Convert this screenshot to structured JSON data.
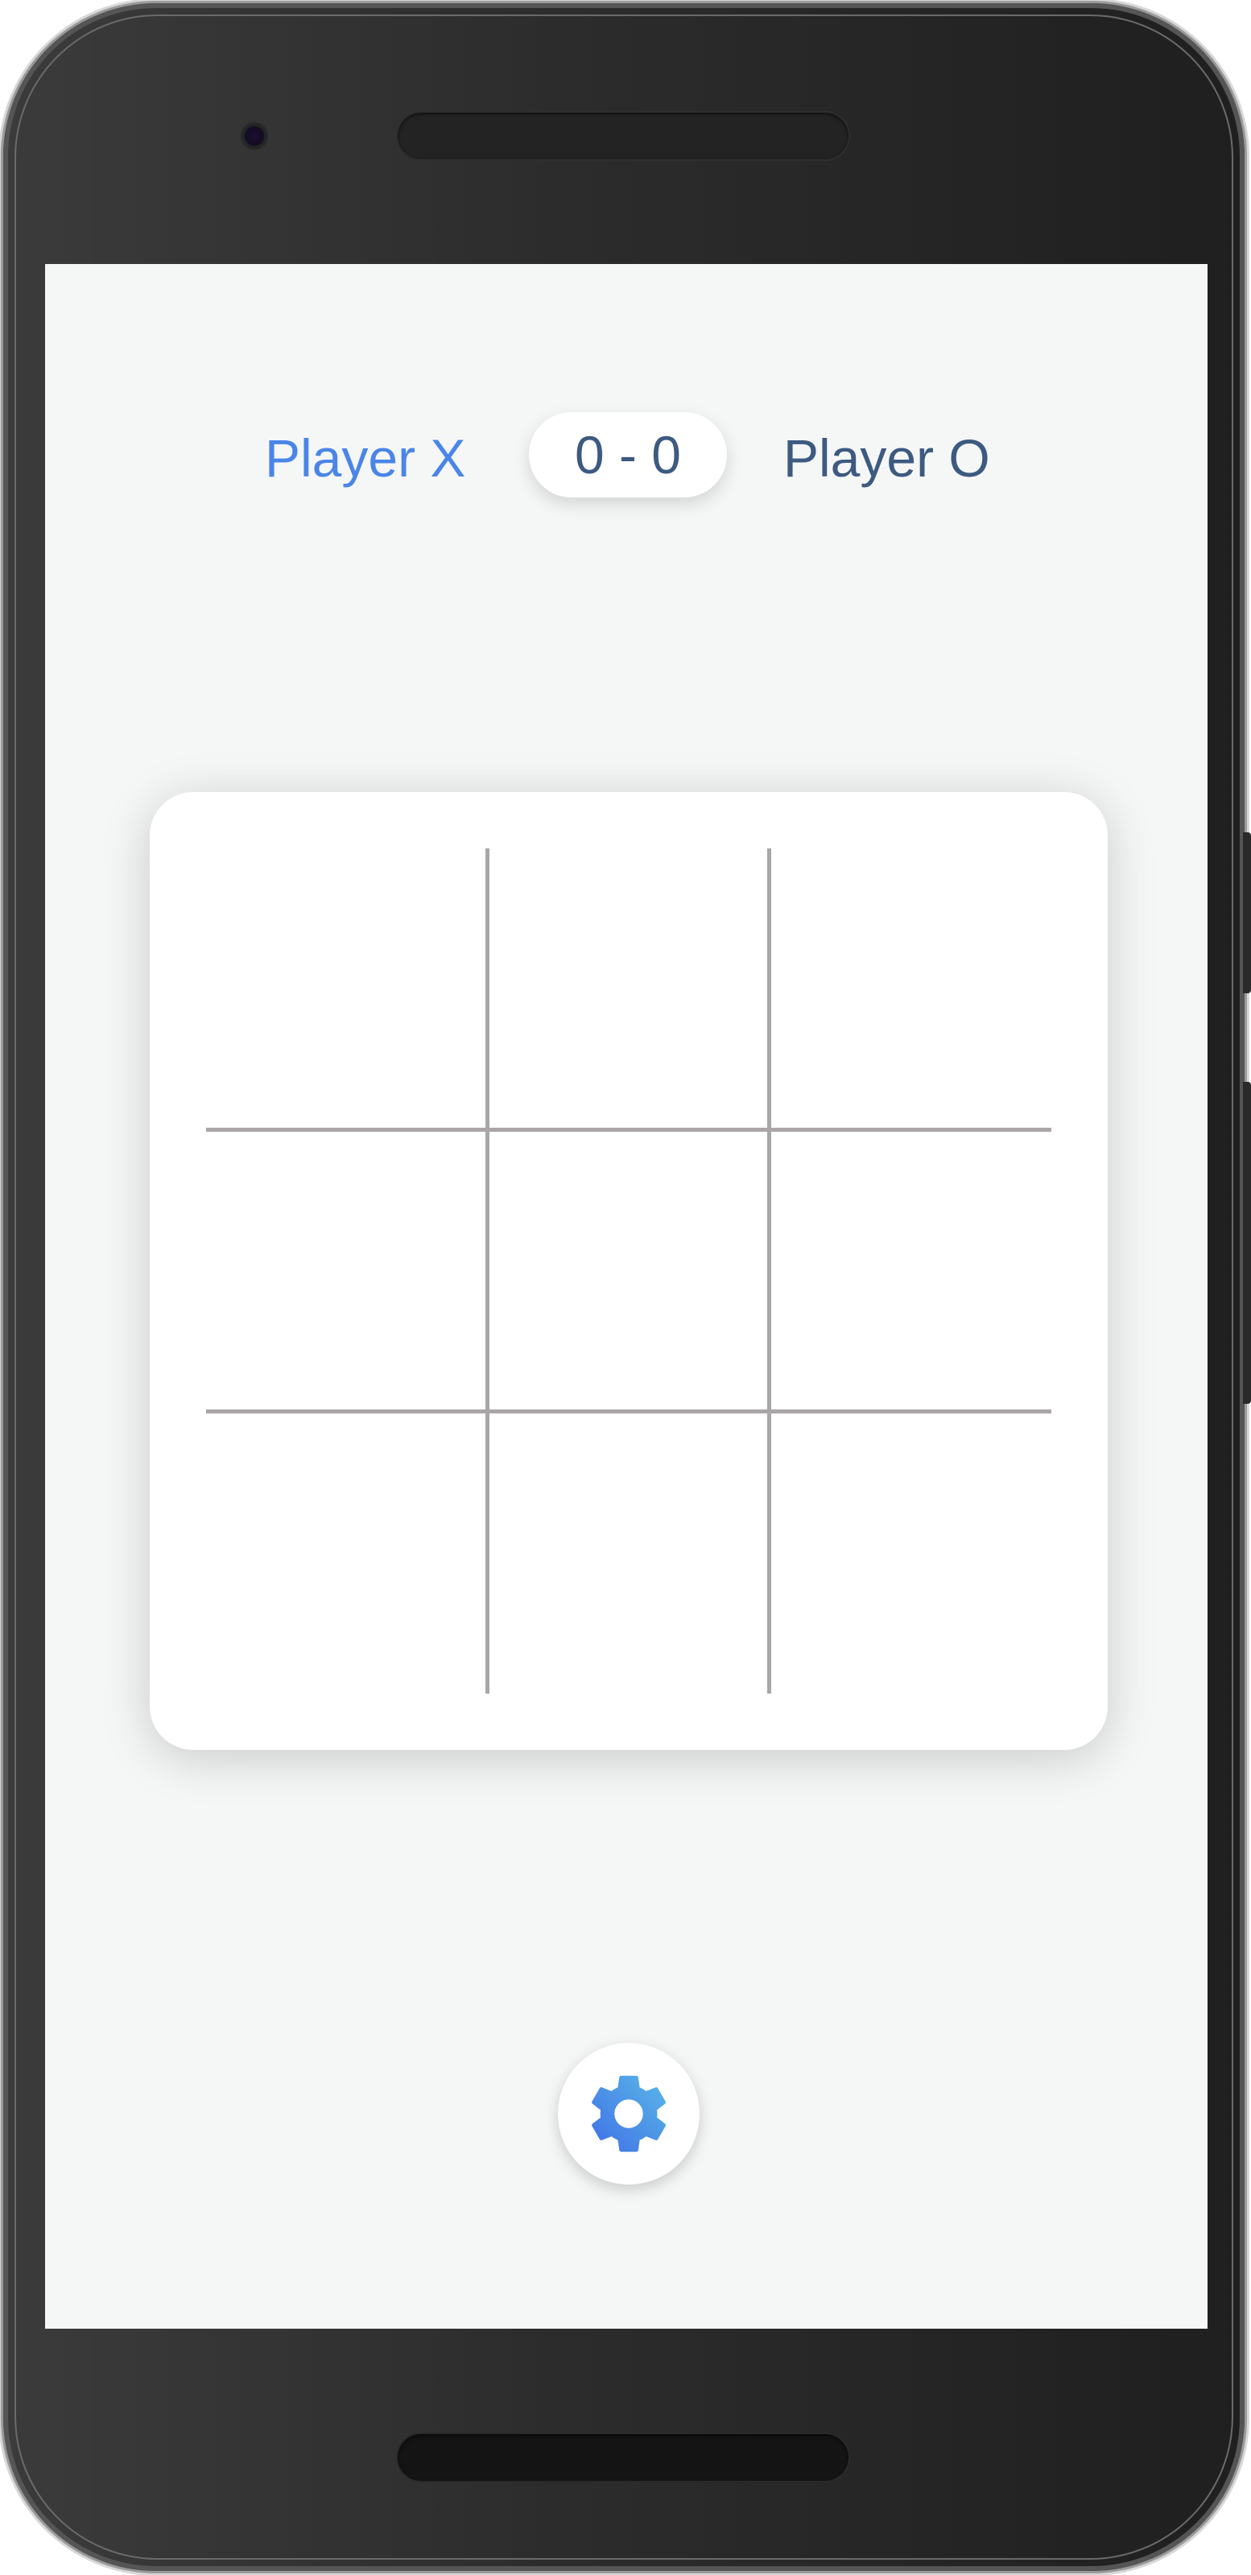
{
  "scoreboard": {
    "player_x_label": "Player X",
    "score_text": "0 - 0",
    "player_o_label": "Player O"
  },
  "board": {
    "rows": 3,
    "cols": 3,
    "cells": [
      "",
      "",
      "",
      "",
      "",
      "",
      "",
      "",
      ""
    ]
  },
  "settings": {
    "icon": "gear-icon"
  },
  "colors": {
    "player_x": "#4a85e8",
    "player_o": "#3d5a80",
    "grid": "#aaa6a8",
    "screen_bg": "#f5f7f6",
    "gear_gradient_start": "#5ab8e8",
    "gear_gradient_end": "#3f6fe6"
  }
}
